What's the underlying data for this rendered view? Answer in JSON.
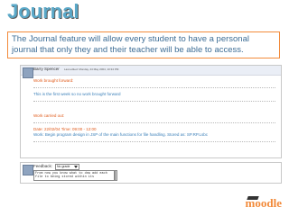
{
  "page": {
    "title": "Journal",
    "intro": "The Journal feature will allow every student to have a personal journal that only they and their teacher will be able to access."
  },
  "entry": {
    "user_name": "Barry Spencer",
    "updated": "Last edited: Monday, 24 May 2004, 10:34 PM",
    "sections": {
      "brought_label": "Work brought forward:",
      "brought_text": "This is the first week so no work brought forward",
      "carried_label": "Work carried out:",
      "date_label": "Date: 22/02/04 Time: 09:00 - 12:00",
      "work_text": "Work: Begin program design in JSP of the main functions for file handling. Stored as: SP.RP.Lsbc"
    }
  },
  "feedback": {
    "label": "Feedback:",
    "grade_selected": "No grade",
    "comment": "From now you know what to dow add each file to being stored within its"
  },
  "logo": {
    "text": "moodle",
    "accent_color": "#f28a3a"
  },
  "colors": {
    "title": "#5aa8c8",
    "intro_text": "#3e6e96",
    "intro_border": "#f28a3a",
    "section_label": "#e05a1a",
    "section_text": "#3a7fb8"
  }
}
